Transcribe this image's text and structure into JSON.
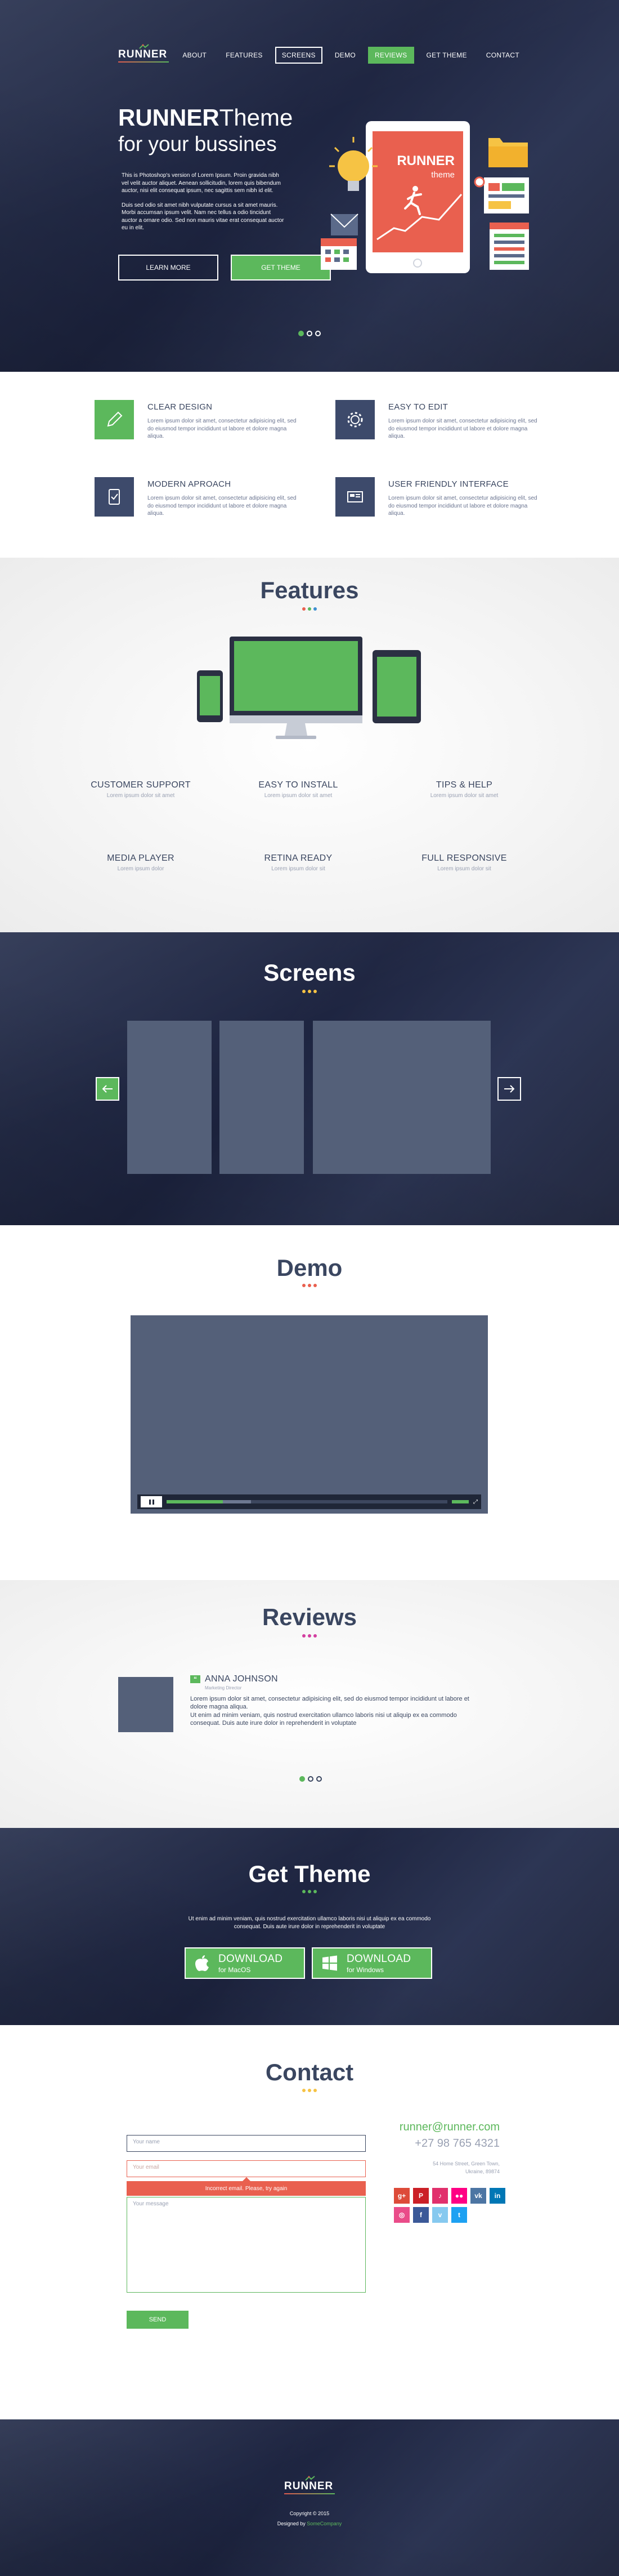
{
  "colors": {
    "green": "#5cb85c",
    "navy": "#3d4a6b",
    "red": "#e9604f",
    "dark": "#1d2440"
  },
  "logo": {
    "text": "RUNNER"
  },
  "nav": {
    "items": [
      {
        "label": "ABOUT",
        "state": "plain"
      },
      {
        "label": "FEATURES",
        "state": "plain"
      },
      {
        "label": "SCREENS",
        "state": "outlined"
      },
      {
        "label": "DEMO",
        "state": "plain"
      },
      {
        "label": "REVIEWS",
        "state": "active"
      },
      {
        "label": "GET THEME",
        "state": "plain"
      },
      {
        "label": "CONTACT",
        "state": "plain"
      }
    ]
  },
  "hero": {
    "title_bold": "RUNNER",
    "title_light": "Theme",
    "subtitle": "for your bussines",
    "para1": "This is Photoshop's version  of Lorem Ipsum. Proin gravida nibh vel velit auctor aliquet. Aenean sollicitudin, lorem quis bibendum auctor, nisi elit consequat ipsum, nec sagittis sem nibh id elit.",
    "para2": "Duis sed odio sit amet nibh vulputate cursus a sit amet mauris. Morbi accumsan ipsum velit. Nam nec tellus a odio tincidunt auctor a ornare odio. Sed non  mauris vitae erat consequat auctor eu in elit.",
    "learn_more": "LEARN MORE",
    "get_theme": "GET THEME",
    "device_title": "RUNNER",
    "device_sub": "theme",
    "slides": 3,
    "active_slide": 1
  },
  "benefits": [
    {
      "title": "CLEAR DESIGN",
      "text": "Lorem ipsum dolor sit amet, consectetur adipisicing elit, sed do eiusmod tempor incididunt ut labore et dolore magna aliqua.",
      "icon": "pencil-icon"
    },
    {
      "title": "EASY TO EDIT",
      "text": "Lorem ipsum dolor sit amet, consectetur adipisicing elit, sed do eiusmod tempor incididunt ut labore et dolore magna aliqua.",
      "icon": "gear-icon"
    },
    {
      "title": "MODERN APROACH",
      "text": "Lorem ipsum dolor sit amet, consectetur adipisicing elit, sed do eiusmod tempor incididunt ut labore et dolore magna aliqua.",
      "icon": "checkmark-phone-icon"
    },
    {
      "title": "USER FRIENDLY INTERFACE",
      "text": "Lorem ipsum dolor sit amet, consectetur adipisicing elit, sed do eiusmod tempor incididunt ut labore et dolore magna aliqua.",
      "icon": "interface-icon"
    }
  ],
  "features": {
    "title": "Features",
    "items": [
      {
        "title": "CUSTOMER SUPPORT",
        "text": "Lorem ipsum dolor sit amet"
      },
      {
        "title": "EASY TO INSTALL",
        "text": "Lorem ipsum dolor sit amet"
      },
      {
        "title": "TIPS & HELP",
        "text": "Lorem ipsum dolor sit amet"
      },
      {
        "title": "MEDIA PLAYER",
        "text": "Lorem ipsum dolor"
      },
      {
        "title": "RETINA READY",
        "text": "Lorem ipsum dolor sit"
      },
      {
        "title": "FULL RESPONSIVE",
        "text": "Lorem ipsum dolor sit"
      }
    ]
  },
  "screens": {
    "title": "Screens"
  },
  "demo": {
    "title": "Demo",
    "progress": 0.2,
    "buffered": 0.3
  },
  "reviews": {
    "title": "Reviews",
    "name": "ANNA JOHNSON",
    "role": "Marketing Director",
    "line1": "Lorem ipsum dolor sit amet, consectetur adipisicing elit, sed do eiusmod tempor incididunt ut labore et dolore magna aliqua.",
    "line2": "Ut enim ad minim veniam, quis nostrud exercitation ullamco laboris nisi ut aliquip ex ea commodo consequat. Duis aute irure dolor in reprehenderit in voluptate",
    "slides": 3,
    "active_slide": 1
  },
  "get_theme": {
    "title": "Get Theme",
    "text": "Ut enim ad minim veniam, quis nostrud exercitation ullamco laboris nisi ut aliquip ex ea commodo consequat. Duis aute irure dolor in reprehenderit in voluptate",
    "mac_big": "DOWNLOAD",
    "mac_small": "for MacOS",
    "win_big": "DOWNLOAD",
    "win_small": "for Windows"
  },
  "contact": {
    "title": "Contact",
    "name_placeholder": "Your name",
    "email_placeholder": "Your email",
    "error": "Incorrect email. Please, try again",
    "message_placeholder": "Your message",
    "send": "SEND",
    "email": "runner@runner.com",
    "phone": "+27 98 765 4321",
    "address1": "54 Home Street, Green Town,",
    "address2": "Ukraine, 89874",
    "socials": [
      {
        "label": "g+",
        "color": "#dd4b39",
        "icon": "google-plus-icon"
      },
      {
        "label": "P",
        "color": "#cb2027",
        "icon": "pinterest-icon"
      },
      {
        "label": "♪",
        "color": "#e1306c",
        "icon": "music-icon"
      },
      {
        "label": "●●",
        "color": "#ff0084",
        "icon": "flickr-icon"
      },
      {
        "label": "vk",
        "color": "#4c75a3",
        "icon": "vk-icon"
      },
      {
        "label": "in",
        "color": "#0077b5",
        "icon": "linkedin-icon"
      },
      {
        "label": "◎",
        "color": "#ea4c89",
        "icon": "dribbble-icon"
      },
      {
        "label": "f",
        "color": "#3b5998",
        "icon": "facebook-icon"
      },
      {
        "label": "v",
        "color": "#86c9ef",
        "icon": "vimeo-icon"
      },
      {
        "label": "t",
        "color": "#1da1f2",
        "icon": "twitter-icon"
      }
    ]
  },
  "footer": {
    "copyright": "Copyright © 2015",
    "designed_by": "Designed by",
    "company": "SomeCompany"
  }
}
